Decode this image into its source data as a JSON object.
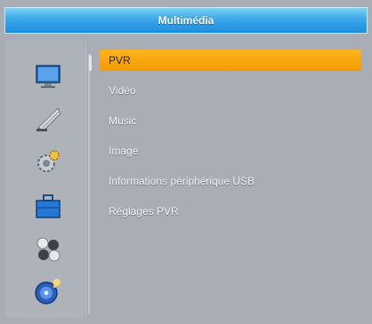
{
  "header": {
    "title": "Multimédia"
  },
  "left_icons": [
    {
      "icon": "monitor-icon"
    },
    {
      "icon": "satellite-dish-icon"
    },
    {
      "icon": "gear-settings-icon"
    },
    {
      "icon": "toolbox-icon"
    },
    {
      "icon": "games-icon"
    },
    {
      "icon": "media-disc-icon"
    }
  ],
  "menu": {
    "items": [
      {
        "label": "PVR",
        "selected": true
      },
      {
        "label": "Vidéo",
        "selected": false
      },
      {
        "label": "Music",
        "selected": false
      },
      {
        "label": "Image",
        "selected": false
      },
      {
        "label": "Informations périphérique USB",
        "selected": false
      },
      {
        "label": "Réglages PVR",
        "selected": false
      }
    ]
  },
  "colors": {
    "title_bar": "#3aa7e8",
    "selected_bg": "#f39a00",
    "panel_bg": "#a9aeb6"
  }
}
